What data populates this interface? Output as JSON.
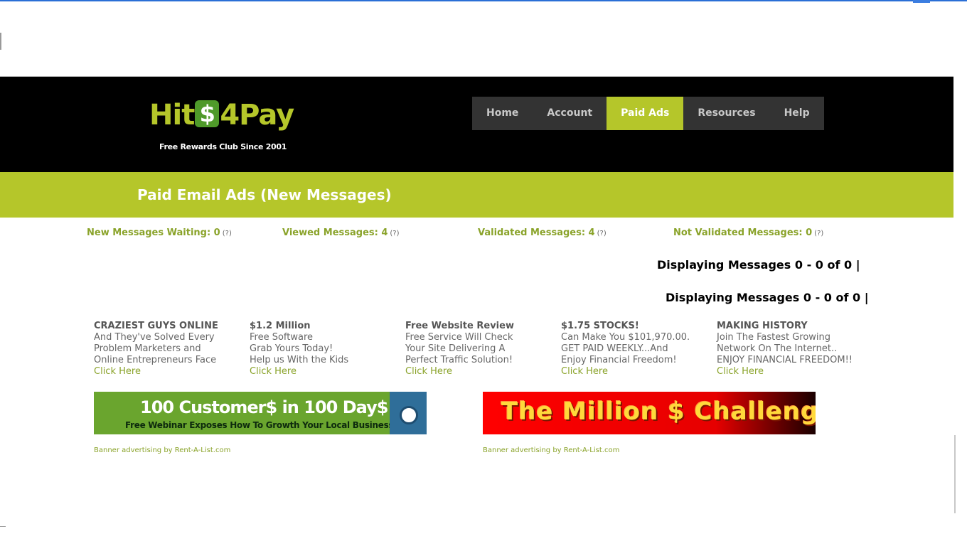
{
  "brand": {
    "logo_prefix": "Hit",
    "logo_symbol": "$",
    "logo_suffix": "4Pay",
    "tagline": "Free Rewards Club Since 2001",
    "accent_color": "#b5c62a"
  },
  "nav": {
    "items": [
      {
        "label": "Home"
      },
      {
        "label": "Account"
      },
      {
        "label": "Paid Ads"
      },
      {
        "label": "Resources"
      },
      {
        "label": "Help"
      }
    ],
    "active": "Paid Ads"
  },
  "page": {
    "title": "Paid Email Ads (New Messages)"
  },
  "stats": {
    "new_waiting": "New Messages Waiting: 0",
    "viewed": "Viewed Messages: 4",
    "validated": "Validated Messages: 4",
    "not_validated": "Not Validated Messages: 0",
    "help_marker": "(?)"
  },
  "displaying": {
    "top": "Displaying Messages 0 - 0 of 0  |",
    "bottom": "Displaying Messages 0 - 0 of 0  |"
  },
  "text_ads": [
    {
      "title": "CRAZIEST GUYS ONLINE",
      "lines": [
        "And They've Solved Every",
        "Problem Marketers and",
        "Online Entrepreneurs Face"
      ],
      "link": "Click Here"
    },
    {
      "title": "$1.2 Million",
      "lines": [
        "Free Software",
        "Grab Yours Today!",
        "Help us With the Kids"
      ],
      "link": "Click Here"
    },
    {
      "title": "Free Website Review",
      "lines": [
        "Free Service Will Check",
        "Your Site Delivering A",
        "Perfect Traffic Solution!"
      ],
      "link": "Click Here"
    },
    {
      "title": "$1.75 STOCKS!",
      "lines": [
        "Can Make You $101,970.00.",
        "GET PAID WEEKLY...And",
        "Enjoy Financial Freedom!"
      ],
      "link": "Click Here"
    },
    {
      "title": "MAKING HISTORY",
      "lines": [
        "Join The Fastest Growing",
        "Network On The Internet..",
        "ENJOY FINANCIAL FREEDOM!!"
      ],
      "link": "Click Here"
    }
  ],
  "banners": {
    "left": {
      "headline": "100 Customer$  in 100 Day$",
      "subline": "Free Webinar Exposes  How To Growth Your Local Business",
      "credit": "Banner advertising by Rent-A-List.com"
    },
    "right": {
      "headline": "The Million $ Challenge",
      "credit": "Banner advertising by Rent-A-List.com"
    }
  }
}
